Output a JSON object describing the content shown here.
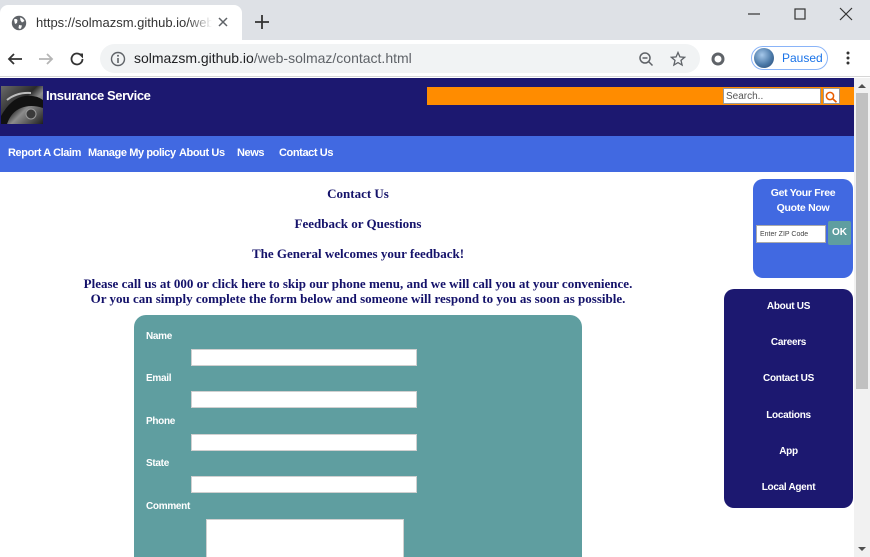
{
  "browser": {
    "tab_title": "https://solmazsm.github.io/web-solmaz/contact.html",
    "url_host": "solmazsm.github.io",
    "url_path": "/web-solmaz/contact.html",
    "profile_status": "Paused"
  },
  "site": {
    "brand": "Insurance Service",
    "search_placeholder": "Search.."
  },
  "nav": {
    "items": [
      "Report A Claim",
      "Manage My policy",
      "About Us",
      "News",
      "Contact Us"
    ]
  },
  "content": {
    "heading": "Contact Us",
    "subheading": "Feedback or Questions",
    "welcome": "The General welcomes your feedback!",
    "instructions_line1": "Please call us at 000 or click here to skip our phone menu, and we will call you at your convenience.",
    "instructions_line2": "Or you can simply complete the form below and someone will respond to you as soon as possible."
  },
  "form": {
    "name_label": "Name",
    "email_label": "Email",
    "phone_label": "Phone",
    "state_label": "State",
    "comment_label": "Comment"
  },
  "quote": {
    "title": "Get Your Free Quote Now",
    "zip_placeholder": "Enter ZIP Code",
    "ok_label": "OK"
  },
  "side_menu": {
    "items": [
      "About US",
      "Careers",
      "Contact US",
      "Locations",
      "App",
      "Local Agent"
    ]
  },
  "colors": {
    "header": "#1c1870",
    "nav": "#4169e1",
    "search_bar": "#ff8c00",
    "form_panel": "#5f9ea0",
    "text": "#14126a"
  }
}
